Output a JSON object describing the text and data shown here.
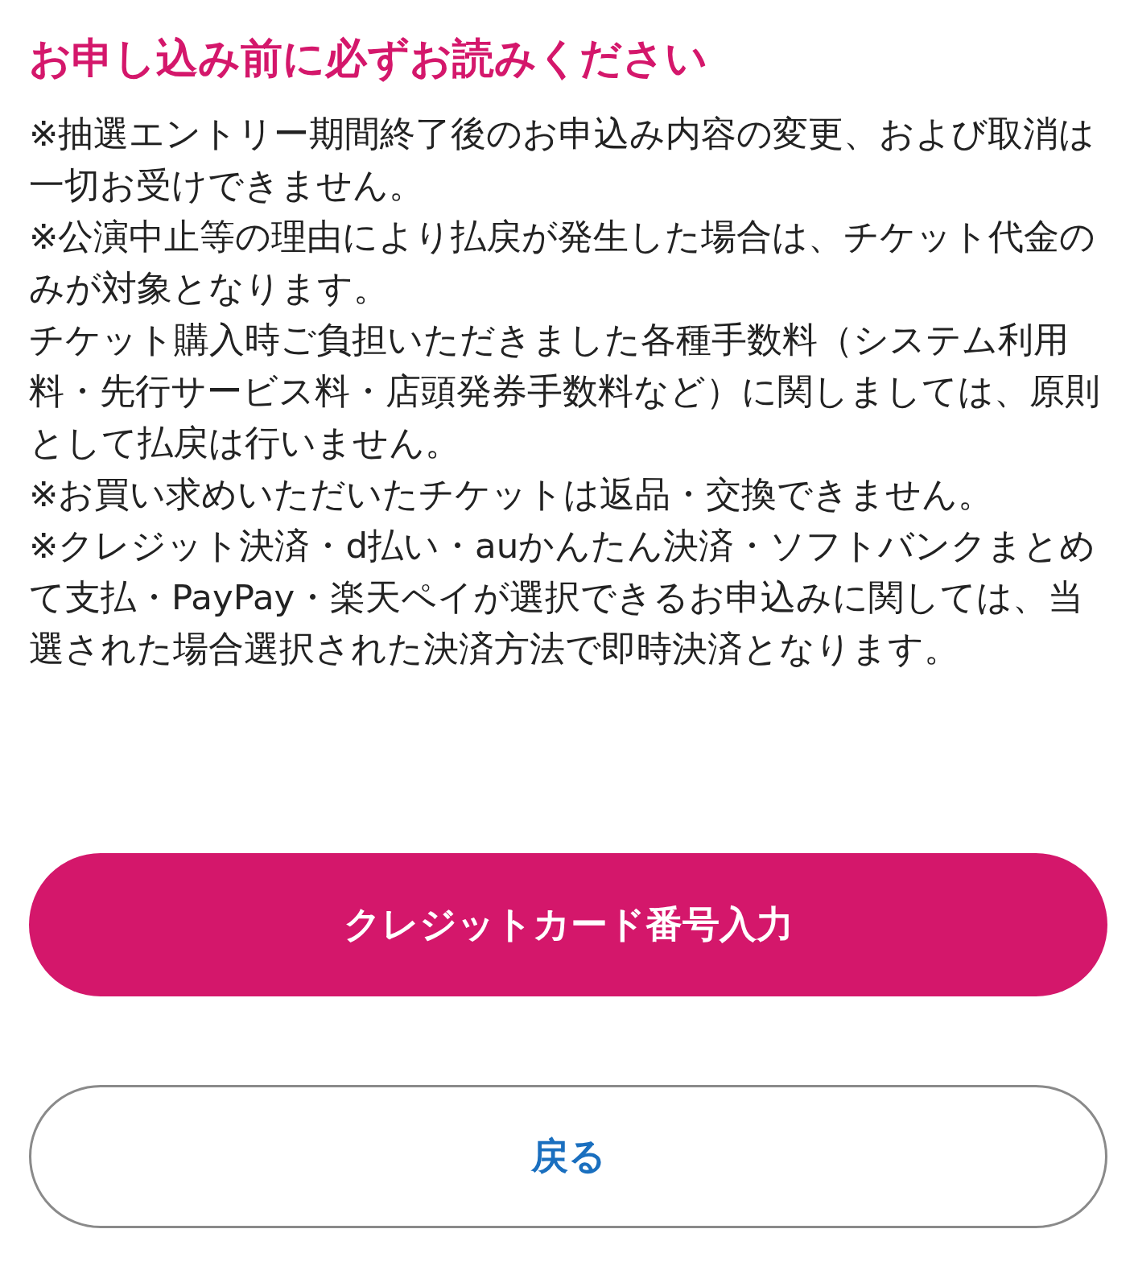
{
  "notice": {
    "title": "お申し込み前に必ずお読みください",
    "paragraphs": [
      "※抽選エントリー期間終了後のお申込み内容の変更、および取消は一切お受けできません。",
      "※公演中止等の理由により払戻が発生した場合は、チケット代金のみが対象となります。",
      "チケット購入時ご負担いただきました各種手数料（システム利用料・先行サービス料・店頭発券手数料など）に関しましては、原則として払戻は行いません。",
      "※お買い求めいただいたチケットは返品・交換できません。",
      "※クレジット決済・d払い・auかんたん決済・ソフトバンクまとめて支払・PayPay・楽天ペイが選択できるお申込みに関しては、当選された場合選択された決済方法で即時決済となります。"
    ]
  },
  "buttons": [
    {
      "label": "クレジットカード番号入力",
      "kind": "primary"
    },
    {
      "label": "戻る",
      "kind": "secondary"
    }
  ]
}
